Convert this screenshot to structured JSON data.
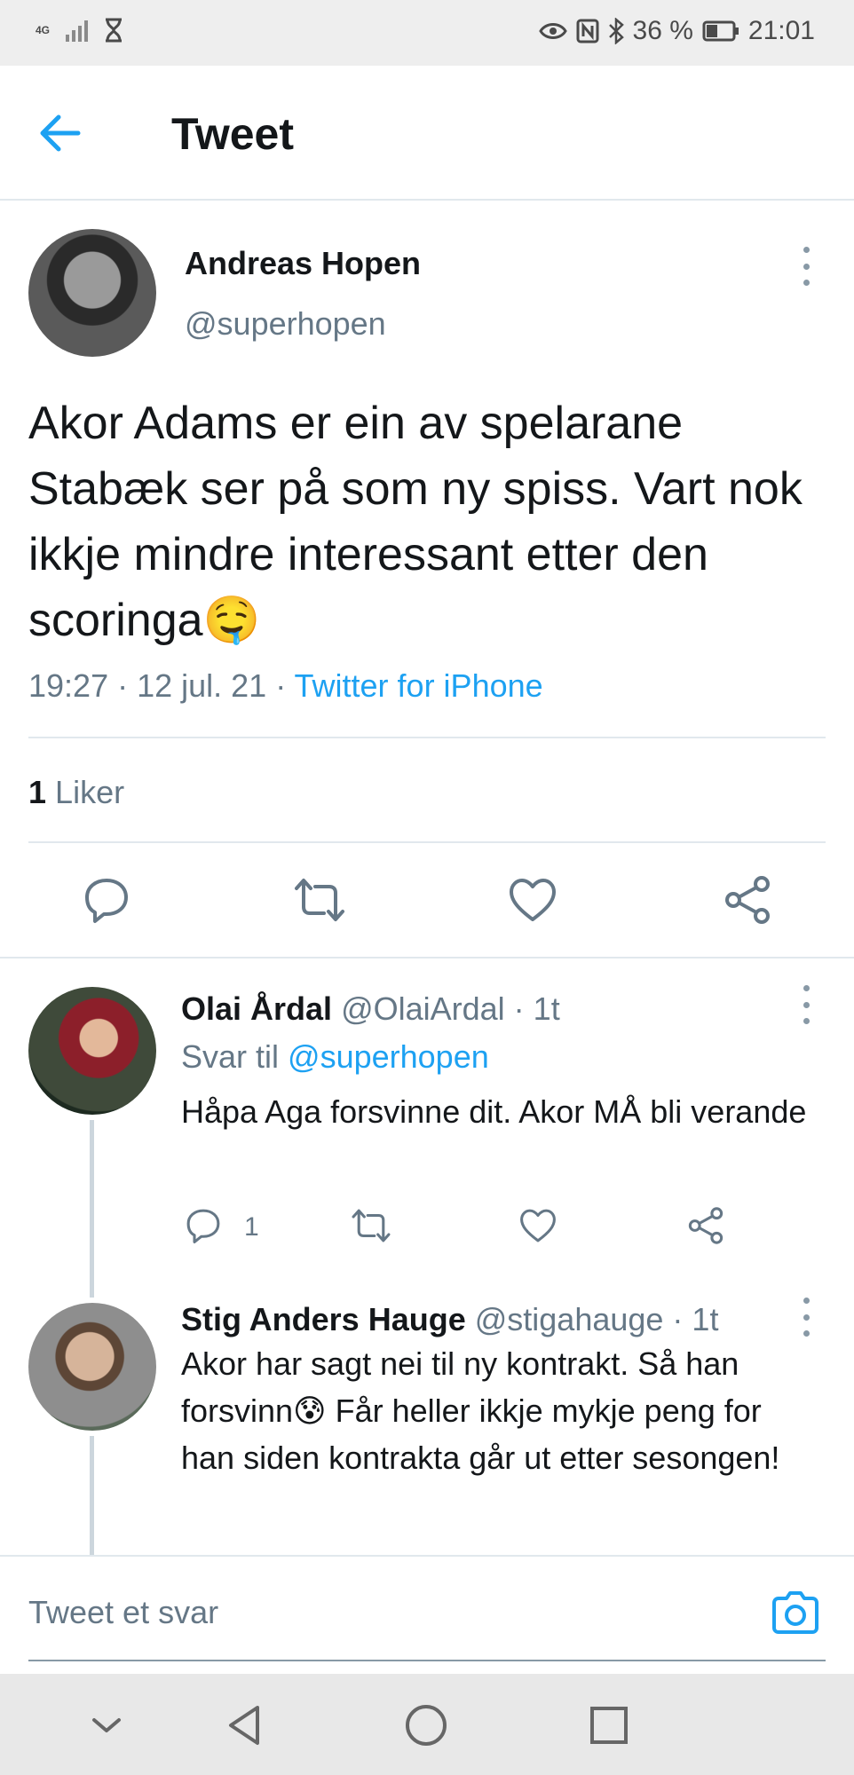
{
  "status_bar": {
    "network": "4G",
    "battery": "36 %",
    "time": "21:01",
    "icons": [
      "signal-icon",
      "hourglass-icon",
      "eye-icon",
      "nfc-icon",
      "bluetooth-icon",
      "battery-icon"
    ]
  },
  "header": {
    "title": "Tweet",
    "back_icon": "arrow-left-icon"
  },
  "tweet": {
    "author_name": "Andreas Hopen",
    "author_handle": "@superhopen",
    "text": "Akor Adams er ein av spelarane Stabæk ser på som ny spiss. Vart nok ikkje mindre interessant etter den scoringa🤤",
    "timestamp": "19:27 · 12 jul. 21 · ",
    "source": "Twitter for iPhone",
    "likes_count": "1",
    "likes_label": "Liker",
    "actions": [
      "reply-icon",
      "retweet-icon",
      "like-icon",
      "share-icon"
    ]
  },
  "replies": [
    {
      "name": "Olai Årdal",
      "handle": "@OlaiArdal · 1t",
      "reply_to_label": "Svar til ",
      "reply_to_handle": "@superhopen",
      "text": "Håpa Aga forsvinne dit. Akor MÅ bli verande",
      "reply_count": "1"
    },
    {
      "name": "Stig Anders Hauge",
      "handle": "@stigahauge · 1t",
      "text": "Akor har sagt nei til ny kontrakt. Så han forsvinn😰 Får heller ikkje mykje peng for han siden kontrakta går ut etter sesongen!"
    }
  ],
  "composer": {
    "placeholder": "Tweet et svar",
    "camera_icon": "camera-icon"
  },
  "nav_bar": {
    "buttons": [
      "chevron-down-icon",
      "back-triangle-icon",
      "home-circle-icon",
      "recents-square-icon"
    ]
  },
  "colors": {
    "accent": "#1da1f2",
    "secondary_text": "#657786",
    "primary_text": "#14171a",
    "divider": "#e1e8ed"
  }
}
